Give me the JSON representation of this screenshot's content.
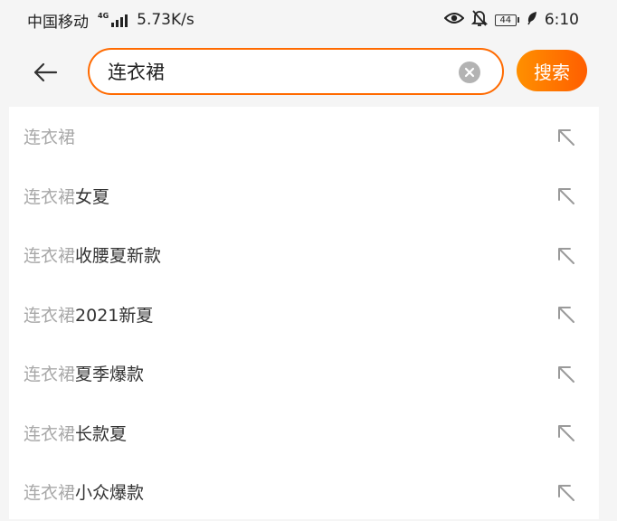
{
  "status_bar": {
    "carrier": "中国移动",
    "network_type": "4G",
    "speed": "5.73K/s",
    "battery": "44",
    "time": "6:10",
    "icons": [
      "eye-icon",
      "bell-off-icon",
      "battery-icon",
      "leaf-icon"
    ]
  },
  "search": {
    "query": "连衣裙",
    "button_label": "搜索",
    "back_icon": "arrow-left-icon",
    "clear_icon": "clear-icon"
  },
  "suggestions": [
    {
      "keyword": "连衣裙",
      "rest": ""
    },
    {
      "keyword": "连衣裙",
      "rest": "女夏"
    },
    {
      "keyword": "连衣裙",
      "rest": "收腰夏新款"
    },
    {
      "keyword": "连衣裙",
      "rest": "2021新夏"
    },
    {
      "keyword": "连衣裙",
      "rest": "夏季爆款"
    },
    {
      "keyword": "连衣裙",
      "rest": "长款夏"
    },
    {
      "keyword": "连衣裙",
      "rest": "小众爆款"
    }
  ],
  "colors": {
    "accent": "#ff6a00",
    "button_gradient_start": "#ff9000",
    "button_gradient_end": "#ff5e00",
    "muted_text": "#a8a8a8"
  }
}
